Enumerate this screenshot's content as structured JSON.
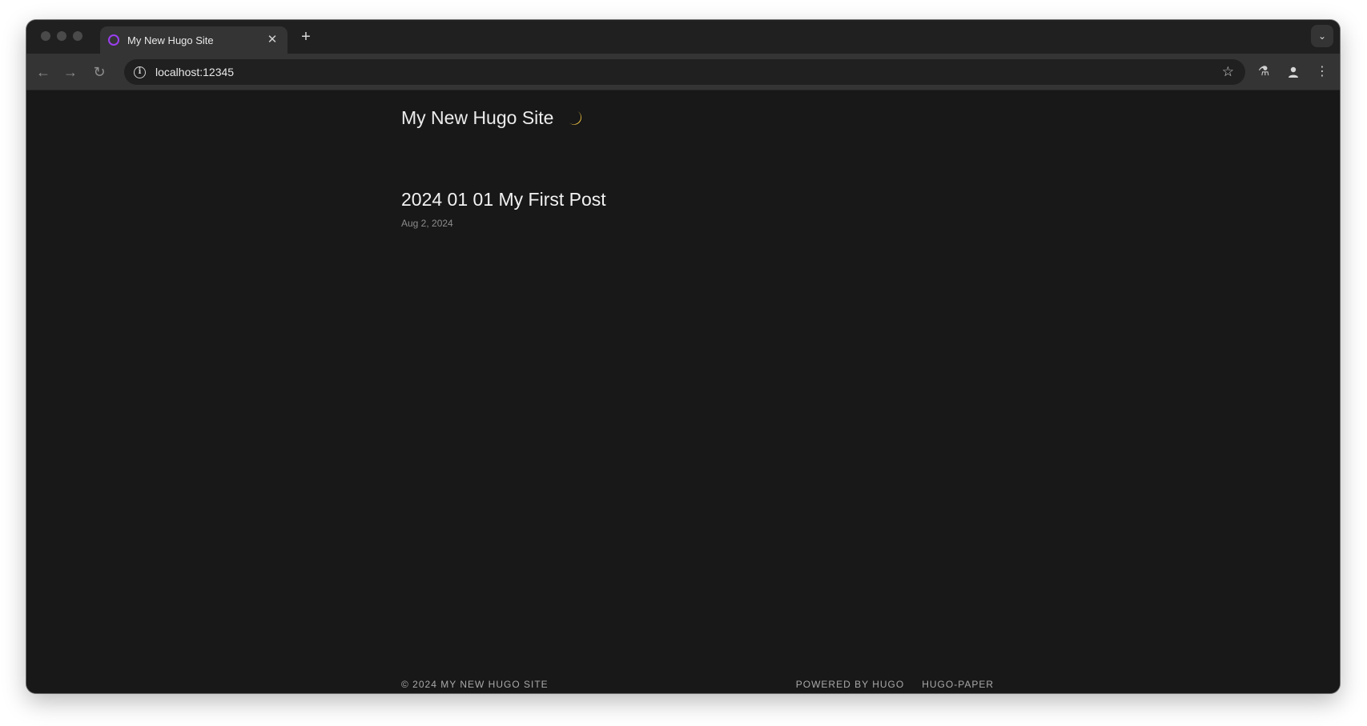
{
  "browser": {
    "tab": {
      "title": "My New Hugo Site",
      "close": "✕"
    },
    "new_tab": "+",
    "address": {
      "url": "localhost:12345"
    }
  },
  "site": {
    "title": "My New Hugo Site",
    "theme_icon": "moon-icon"
  },
  "posts": [
    {
      "title": "2024 01 01 My First Post",
      "date": "Aug 2, 2024"
    }
  ],
  "footer": {
    "copyright": "© 2024 MY NEW HUGO SITE",
    "links": [
      "POWERED BY HUGO",
      "HUGO-PAPER"
    ]
  },
  "colors": {
    "page_bg": "#181818",
    "tab_favicon": "#9b3ff0",
    "moon": "#f5c842"
  }
}
